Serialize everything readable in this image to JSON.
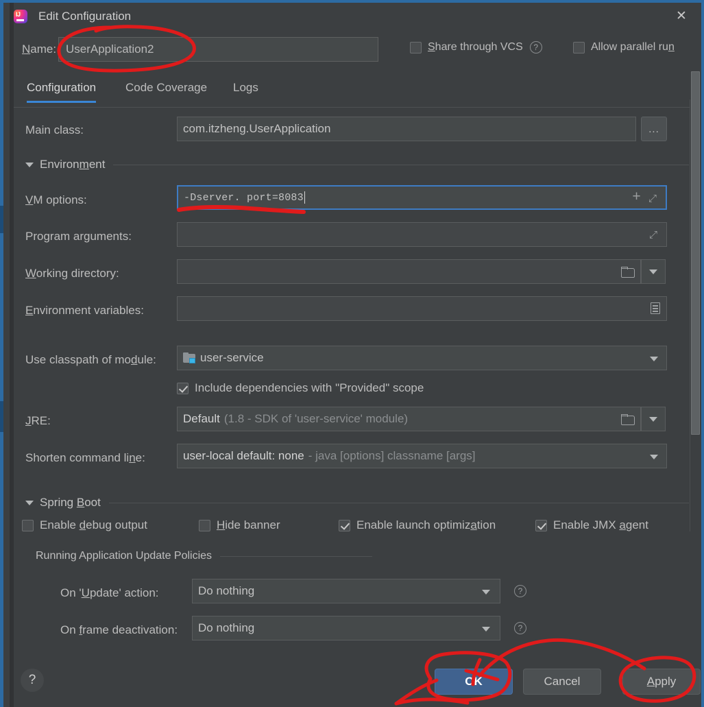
{
  "window": {
    "title": "Edit Configuration",
    "app_icon": "intellij-idea-icon",
    "close_icon": "✕"
  },
  "name_row": {
    "label": "Name:",
    "label_mnemonic": "N",
    "value": "UserApplication2",
    "share_vcs": {
      "label": "Share through VCS",
      "mnemonic": "S",
      "checked": false,
      "help_icon": "?"
    },
    "allow_parallel": {
      "label": "Allow parallel run",
      "mnemonic": "n",
      "checked": false
    }
  },
  "tabs": [
    {
      "label": "Configuration",
      "active": true
    },
    {
      "label": "Code Coverage",
      "active": false
    },
    {
      "label": "Logs",
      "active": false
    }
  ],
  "form": {
    "main_class": {
      "label": "Main class:",
      "value": "com.itzheng.UserApplication",
      "browse_label": "..."
    },
    "environment_section": {
      "title": "Environment",
      "mnemonic": "m",
      "expanded": true
    },
    "vm_options": {
      "label": "VM options:",
      "mnemonic": "V",
      "value": "-Dserver. port=8083",
      "focused": true,
      "add_icon": "+",
      "expand_icon": "⤢"
    },
    "program_arguments": {
      "label": "Program arguments:",
      "value": "",
      "expand_icon": "⤢"
    },
    "working_directory": {
      "label": "Working directory:",
      "mnemonic": "W",
      "value": "",
      "folder_icon": "folder-icon",
      "dropdown_icon": "▼"
    },
    "environment_variables": {
      "label": "Environment variables:",
      "mnemonic": "E",
      "value": "",
      "list_icon": "env-list-icon"
    },
    "use_classpath": {
      "label": "Use classpath of module:",
      "mnemonic": "d",
      "value": "user-service",
      "module_icon": "module-icon",
      "dropdown_icon": "▼"
    },
    "include_provided": {
      "label": "Include dependencies with \"Provided\" scope",
      "checked": true
    },
    "jre": {
      "label": "JRE:",
      "mnemonic": "J",
      "value_primary": "Default",
      "value_secondary": "(1.8 - SDK of 'user-service' module)",
      "folder_icon": "folder-icon",
      "dropdown_icon": "▼"
    },
    "shorten_command_line": {
      "label": "Shorten command line:",
      "mnemonic": "n",
      "value_primary": "user-local default: none",
      "value_secondary": "- java [options] classname [args]",
      "dropdown_icon": "▼"
    },
    "spring_boot_section": {
      "title": "Spring Boot",
      "mnemonic": "B",
      "expanded": true
    },
    "spring_checkboxes": [
      {
        "label": "Enable debug output",
        "mnemonic": "d",
        "checked": false
      },
      {
        "label": "Hide banner",
        "mnemonic": "H",
        "checked": false
      },
      {
        "label": "Enable launch optimization",
        "mnemonic": "a",
        "checked": true
      },
      {
        "label": "Enable JMX agent",
        "mnemonic": "a",
        "checked": true
      }
    ],
    "update_policies": {
      "title": "Running Application Update Policies",
      "on_update": {
        "label": "On 'Update' action:",
        "mnemonic": "U",
        "value": "Do nothing",
        "dropdown_icon": "▼",
        "help_icon": "?"
      },
      "on_frame_deactivation": {
        "label": "On frame deactivation:",
        "mnemonic": "f",
        "value": "Do nothing",
        "dropdown_icon": "▼",
        "help_icon": "?"
      }
    }
  },
  "footer": {
    "help_icon": "?",
    "ok": "OK",
    "cancel": "Cancel",
    "apply": "Apply",
    "apply_mnemonic": "A"
  },
  "colors": {
    "accent_blue": "#3a86d6",
    "primary_button": "#40628f",
    "window_border": "#2d6ba3",
    "annotation_red": "#e01b1b",
    "panel_bg": "#3c3f41",
    "field_bg": "#45494a"
  },
  "scrollbar": {
    "visible": true,
    "orientation": "vertical"
  }
}
